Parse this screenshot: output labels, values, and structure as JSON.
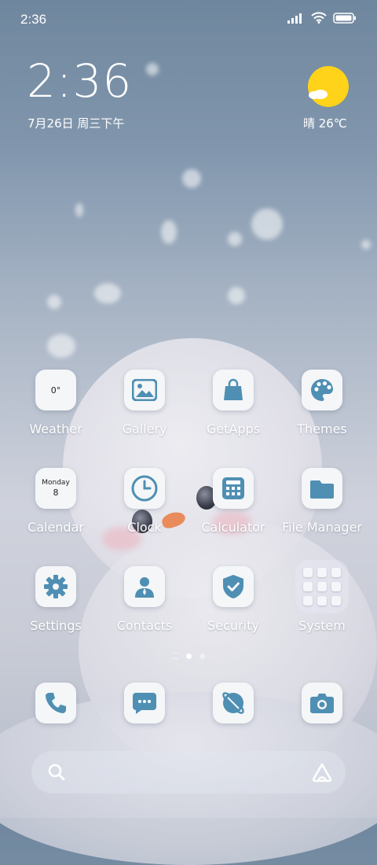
{
  "status_bar": {
    "time": "2:36",
    "icons": [
      "signal-icon",
      "wifi-icon",
      "battery-icon"
    ]
  },
  "clock_widget": {
    "time": "2:36",
    "date": "7月26日 周三下午"
  },
  "weather_widget": {
    "text": "晴 26℃",
    "icon": "sun-cloud-icon",
    "sun_color": "#ffd31a"
  },
  "apps": {
    "weather": {
      "label": "Weather",
      "icon_text": "0°"
    },
    "gallery": {
      "label": "Gallery"
    },
    "getapps": {
      "label": "GetApps"
    },
    "themes": {
      "label": "Themes"
    },
    "calendar": {
      "label": "Calendar",
      "icon_day": "Monday",
      "icon_date": "8"
    },
    "clock": {
      "label": "Clock"
    },
    "calculator": {
      "label": "Calculator"
    },
    "file_manager": {
      "label": "File Manager"
    },
    "settings": {
      "label": "Settings"
    },
    "contacts": {
      "label": "Contacts"
    },
    "security": {
      "label": "Security"
    },
    "system": {
      "label": "System"
    }
  },
  "dock": [
    "phone-icon",
    "messages-icon",
    "browser-icon",
    "camera-icon"
  ],
  "page_indicator": {
    "pages": 2,
    "active": 1
  },
  "search_bar": {
    "left_icon": "search-icon",
    "right_icon": "assistant-icon"
  },
  "colors": {
    "icon_glyph": "#4f8fb3",
    "icon_bg": "#f4f6f8"
  }
}
